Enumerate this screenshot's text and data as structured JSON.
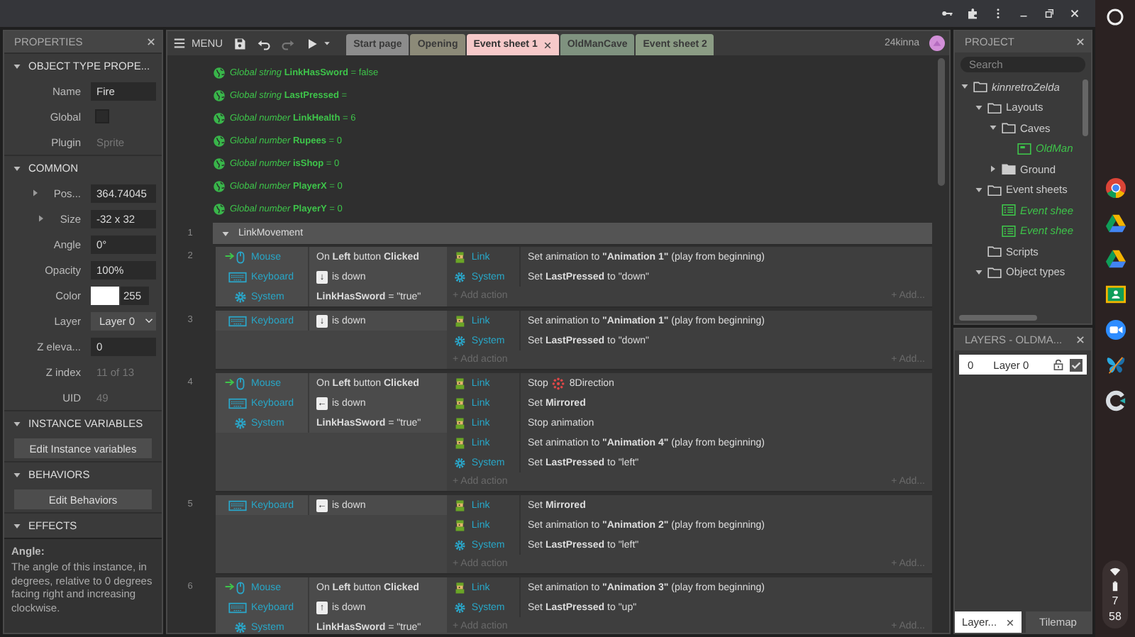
{
  "toolbar": {
    "menu": "MENU",
    "user": "24kinna"
  },
  "tabs": [
    {
      "label": "Start page",
      "selected": false,
      "color": "#8c8c8c"
    },
    {
      "label": "Opening",
      "selected": false,
      "color": "#8c8a78"
    },
    {
      "label": "Event sheet 1",
      "selected": true,
      "color": "#f6c9c9"
    },
    {
      "label": "OldManCave",
      "selected": false,
      "color": "#7f927f"
    },
    {
      "label": "Event sheet 2",
      "selected": false,
      "color": "#8b9c84"
    }
  ],
  "properties": {
    "title": "PROPERTIES",
    "sections": [
      {
        "title": "OBJECT TYPE PROPE...",
        "expanded": true,
        "rows": [
          {
            "kind": "field",
            "label": "Name",
            "value": "Fire"
          },
          {
            "kind": "checkbox",
            "label": "Global",
            "checked": false
          },
          {
            "kind": "static",
            "label": "Plugin",
            "value": "Sprite"
          }
        ]
      },
      {
        "title": "COMMON",
        "expanded": true,
        "rows": [
          {
            "kind": "expandable",
            "label": "Pos...",
            "value": "364.74045"
          },
          {
            "kind": "expandable",
            "label": "Size",
            "value": "-32 x 32"
          },
          {
            "kind": "field",
            "label": "Angle",
            "value": "0°"
          },
          {
            "kind": "field",
            "label": "Opacity",
            "value": "100%"
          },
          {
            "kind": "color",
            "label": "Color",
            "value": "255"
          },
          {
            "kind": "select",
            "label": "Layer",
            "value": "Layer 0"
          },
          {
            "kind": "field",
            "label": "Z eleva...",
            "value": "0"
          },
          {
            "kind": "static",
            "label": "Z index",
            "value": "11 of 13"
          },
          {
            "kind": "static",
            "label": "UID",
            "value": "49"
          }
        ]
      },
      {
        "title": "INSTANCE VARIABLES",
        "expanded": true,
        "rows": [
          {
            "kind": "button",
            "label": "Edit Instance variables"
          }
        ]
      },
      {
        "title": "BEHAVIORS",
        "expanded": true,
        "rows": [
          {
            "kind": "button",
            "label": "Edit Behaviors"
          }
        ]
      },
      {
        "title": "EFFECTS",
        "expanded": true
      }
    ],
    "help_title": "Angle:",
    "help_text": "The angle of this instance, in degrees, relative to 0 degrees facing right and increasing clockwise."
  },
  "globals": [
    "*Global string* **LinkHasSword** = false",
    "*Global string* **LastPressed** =",
    "*Global number* **LinkHealth** = 6",
    "*Global number* **Rupees** = 0",
    "*Global number* **isShop** = 0",
    "*Global number* **PlayerX** = 0",
    "*Global number* **PlayerY** = 0"
  ],
  "group": {
    "number": "1",
    "name": "LinkMovement",
    "expanded": true,
    "events": [
      {
        "number": "2",
        "conditions": [
          {
            "kind": "mouse",
            "object": "Mouse",
            "trigger": true,
            "text": "On **Left** button **Clicked**"
          },
          {
            "kind": "keyboard",
            "object": "Keyboard",
            "trigger": false,
            "key": "↓",
            "text": "is down"
          },
          {
            "kind": "system",
            "object": "System",
            "trigger": false,
            "text": "**LinkHasSword** = \"true\""
          }
        ],
        "actions": [
          {
            "kind": "sprite",
            "object": "Link",
            "text": "Set animation to **\"Animation 1\"** (play from beginning)"
          },
          {
            "kind": "system",
            "object": "System",
            "text": "Set **LastPressed** to \"down\""
          }
        ],
        "add_action": "+ Add action",
        "add_more": "+ Add..."
      },
      {
        "number": "3",
        "conditions": [
          {
            "kind": "keyboard",
            "object": "Keyboard",
            "trigger": false,
            "key": "↓",
            "text": "is down"
          }
        ],
        "actions": [
          {
            "kind": "sprite",
            "object": "Link",
            "text": "Set animation to **\"Animation 1\"** (play from beginning)"
          },
          {
            "kind": "system",
            "object": "System",
            "text": "Set **LastPressed** to \"down\""
          }
        ],
        "add_action": "+ Add action",
        "add_more": "+ Add..."
      },
      {
        "number": "4",
        "conditions": [
          {
            "kind": "mouse",
            "object": "Mouse",
            "trigger": true,
            "text": "On **Left** button **Clicked**"
          },
          {
            "kind": "keyboard",
            "object": "Keyboard",
            "trigger": false,
            "key": "←",
            "text": "is down"
          },
          {
            "kind": "system",
            "object": "System",
            "trigger": false,
            "text": "**LinkHasSword** = \"true\""
          }
        ],
        "actions": [
          {
            "kind": "sprite",
            "object": "Link",
            "text": "Stop",
            "behavior": "8Direction"
          },
          {
            "kind": "sprite",
            "object": "Link",
            "text": "Set **Mirrored**"
          },
          {
            "kind": "sprite",
            "object": "Link",
            "text": "Stop animation"
          },
          {
            "kind": "sprite",
            "object": "Link",
            "text": "Set animation to **\"Animation 4\"** (play from beginning)"
          },
          {
            "kind": "system",
            "object": "System",
            "text": "Set **LastPressed** to \"left\""
          }
        ],
        "add_action": "+ Add action",
        "add_more": "+ Add..."
      },
      {
        "number": "5",
        "conditions": [
          {
            "kind": "keyboard",
            "object": "Keyboard",
            "trigger": false,
            "key": "←",
            "text": "is down"
          }
        ],
        "actions": [
          {
            "kind": "sprite",
            "object": "Link",
            "text": "Set **Mirrored**"
          },
          {
            "kind": "sprite",
            "object": "Link",
            "text": "Set animation to **\"Animation 2\"** (play from beginning)"
          },
          {
            "kind": "system",
            "object": "System",
            "text": "Set **LastPressed** to \"left\""
          }
        ],
        "add_action": "+ Add action",
        "add_more": "+ Add..."
      },
      {
        "number": "6",
        "conditions": [
          {
            "kind": "mouse",
            "object": "Mouse",
            "trigger": true,
            "text": "On **Left** button **Clicked**"
          },
          {
            "kind": "keyboard",
            "object": "Keyboard",
            "trigger": false,
            "key": "↑",
            "text": "is down"
          },
          {
            "kind": "system",
            "object": "System",
            "trigger": false,
            "text": "**LinkHasSword** = \"true\""
          }
        ],
        "actions": [
          {
            "kind": "sprite",
            "object": "Link",
            "text": "Set animation to **\"Animation 3\"** (play from beginning)"
          },
          {
            "kind": "system",
            "object": "System",
            "text": "Set **LastPressed** to \"up\""
          }
        ],
        "add_action": "+ Add action",
        "add_more": "+ Add..."
      }
    ]
  },
  "project": {
    "title": "PROJECT",
    "search_placeholder": "Search",
    "tree": [
      {
        "label": "kinnretroZelda",
        "kind": "project",
        "expanded": true,
        "children": [
          {
            "label": "Layouts",
            "kind": "folder",
            "expanded": true,
            "children": [
              {
                "label": "Caves",
                "kind": "folder",
                "expanded": true,
                "children": [
                  {
                    "label": "OldMan",
                    "kind": "layout"
                  }
                ]
              },
              {
                "label": "Ground",
                "kind": "folder",
                "expanded": false
              }
            ]
          },
          {
            "label": "Event sheets",
            "kind": "folder",
            "expanded": true,
            "children": [
              {
                "label": "Event shee",
                "kind": "sheet"
              },
              {
                "label": "Event shee",
                "kind": "sheet"
              }
            ]
          },
          {
            "label": "Scripts",
            "kind": "folder"
          },
          {
            "label": "Object types",
            "kind": "folder",
            "expanded": true
          }
        ]
      }
    ]
  },
  "layers": {
    "title": "LAYERS - OLDMA...",
    "rows": [
      {
        "index": "0",
        "name": "Layer 0",
        "locked": false,
        "visible": true
      }
    ]
  },
  "bottom_tabs": [
    {
      "label": "Layer...",
      "selected": true
    },
    {
      "label": "Tilemap",
      "selected": false
    }
  ],
  "shelf": {
    "clock": [
      "7",
      "58"
    ]
  }
}
